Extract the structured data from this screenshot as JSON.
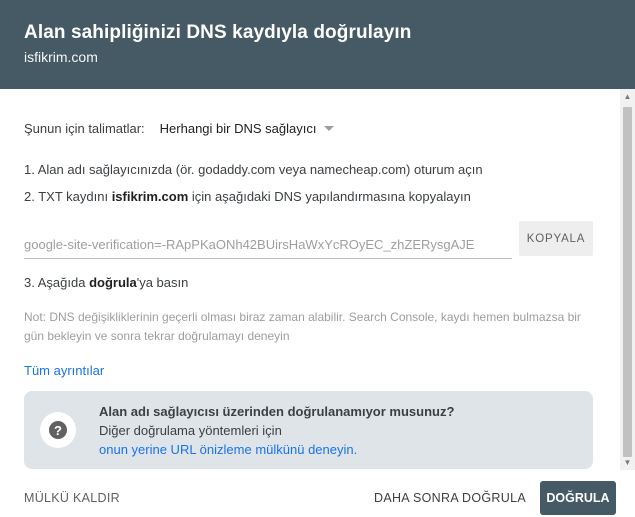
{
  "header": {
    "title": "Alan sahipliğinizi DNS kaydıyla doğrulayın",
    "domain": "isfikrim.com"
  },
  "instructions": {
    "label": "Şunun için talimatlar:",
    "provider_value": "Herhangi bir DNS sağlayıcı"
  },
  "steps": {
    "step1": "1. Alan adı sağlayıcınızda (ör. godaddy.com veya namecheap.com) oturum açın",
    "step2_prefix": "2. TXT kaydını ",
    "step2_bold": "isfikrim.com",
    "step2_suffix": " için aşağıdaki DNS yapılandırmasına kopyalayın",
    "step3_prefix": "3. Aşağıda ",
    "step3_bold": "doğrula",
    "step3_suffix": "'ya basın"
  },
  "txt_record": {
    "value": "google-site-verification=-RApPKaONh42BUirsHaWxYcROyEC_zhZERysgAJE",
    "copy_label": "KOPYALA"
  },
  "note": "Not: DNS değişikliklerinin geçerli olması biraz zaman alabilir. Search Console, kaydı hemen bulmazsa bir gün bekleyin ve sonra tekrar doğrulamayı deneyin",
  "details_link": "Tüm ayrıntılar",
  "info_box": {
    "icon": "question-icon",
    "icon_glyph": "?",
    "title": "Alan adı sağlayıcısı üzerinden doğrulanamıyor musunuz?",
    "line2": "Diğer doğrulama yöntemleri için",
    "link": "onun yerine URL önizleme mülkünü deneyin."
  },
  "footer": {
    "remove_label": "MÜLKÜ KALDIR",
    "later_label": "DAHA SONRA DOĞRULA",
    "verify_label": "DOĞRULA"
  },
  "colors": {
    "header_bg": "#455a64",
    "link": "#1a73e8",
    "info_bg": "#dfe4e9"
  }
}
